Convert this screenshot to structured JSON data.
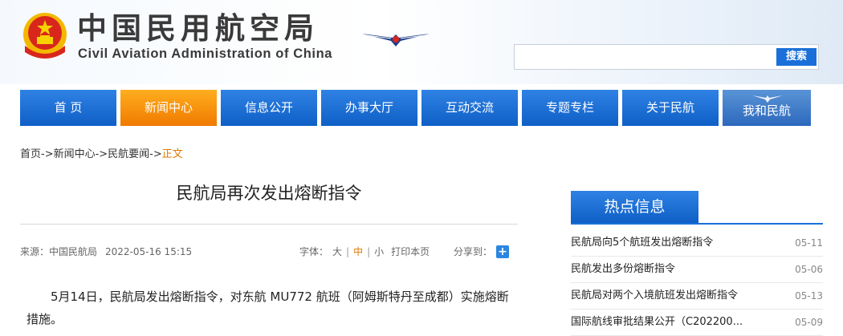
{
  "header": {
    "title_cn": "中国民用航空局",
    "title_en": "Civil Aviation Administration of China",
    "emblem_icon": "national-emblem-icon",
    "logo_icon": "caac-wings-logo-icon",
    "search": {
      "placeholder": "",
      "button_label": "搜索"
    }
  },
  "nav": {
    "items": [
      {
        "label": "首 页"
      },
      {
        "label": "新闻中心",
        "active": true
      },
      {
        "label": "信息公开"
      },
      {
        "label": "办事大厅"
      },
      {
        "label": "互动交流"
      },
      {
        "label": "专题专栏"
      },
      {
        "label": "关于民航"
      },
      {
        "label": "我和民航"
      }
    ]
  },
  "breadcrumb": {
    "path": "首页->新闻中心->民航要闻->",
    "current": "正文"
  },
  "article": {
    "title": "民航局再次发出熔断指令",
    "source": "来源：中国民航局",
    "date": "2022-05-16 15:15",
    "font_size_label": "字体：",
    "font_sizes": [
      "大",
      "中",
      "小"
    ],
    "font_size_active": "中",
    "print_label": "打印本页",
    "share_label": "分享到：",
    "share_icon": "plus-icon",
    "paragraph": "5月14日，民航局发出熔断指令，对东航 MU772 航班（阿姆斯特丹至成都）实施熔断措施。"
  },
  "sidebar": {
    "hot_title": "热点信息",
    "items": [
      {
        "title": "民航局向5个航班发出熔断指令",
        "date": "05-11"
      },
      {
        "title": "民航发出多份熔断指令",
        "date": "05-06"
      },
      {
        "title": "民航局对两个入境航班发出熔断指令",
        "date": "05-13"
      },
      {
        "title": "国际航线审批结果公开（C202200...",
        "date": "05-09"
      }
    ]
  },
  "colors": {
    "nav_blue": "#1a6fd8",
    "nav_active_orange": "#f58a00",
    "breadcrumb_current": "#e07a00"
  }
}
